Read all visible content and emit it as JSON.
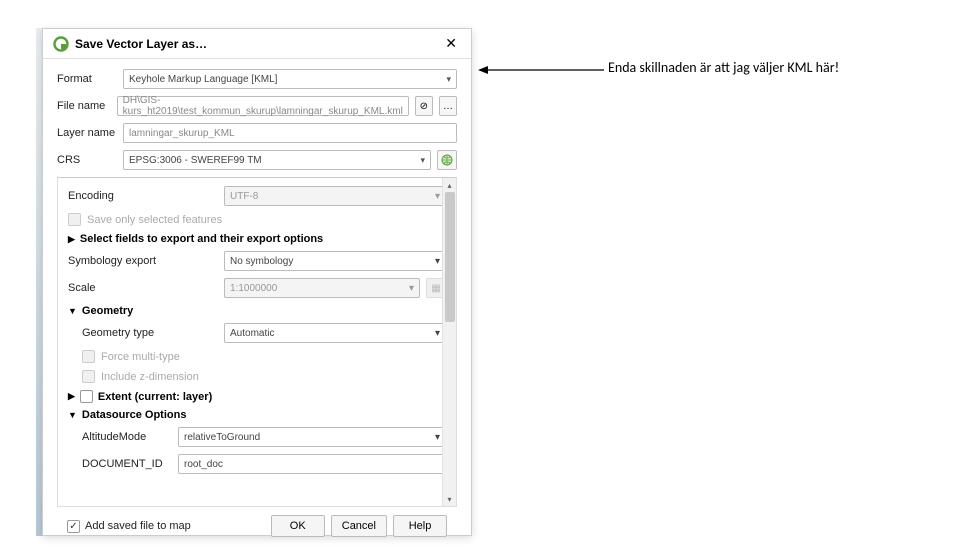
{
  "annotation": "Enda skillnaden är att jag väljer KML här!",
  "dialog": {
    "title": "Save Vector Layer as…",
    "format_label": "Format",
    "format_value": "Keyhole Markup Language [KML]",
    "filename_label": "File name",
    "filename_value": "DH\\GIS-kurs_ht2019\\test_kommun_skurup\\lamningar_skurup_KML.kml",
    "browse_btn": "…",
    "layername_label": "Layer name",
    "layername_value": "lamningar_skurup_KML",
    "crs_label": "CRS",
    "crs_value": "EPSG:3006 - SWEREF99 TM",
    "encoding_label": "Encoding",
    "encoding_value": "UTF-8",
    "save_selected": "Save only selected features",
    "select_fields_head": "Select fields to export and their export options",
    "symbology_label": "Symbology export",
    "symbology_value": "No symbology",
    "scale_label": "Scale",
    "scale_value": "1:1000000",
    "geometry_head": "Geometry",
    "geomtype_label": "Geometry type",
    "geomtype_value": "Automatic",
    "force_multi": "Force multi-type",
    "include_z": "Include z-dimension",
    "extent_head": "Extent (current: layer)",
    "datasource_head": "Datasource Options",
    "altitude_label": "AltitudeMode",
    "altitude_value": "relativeToGround",
    "docid_label": "DOCUMENT_ID",
    "docid_value": "root_doc",
    "add_saved": "Add saved file to map",
    "ok": "OK",
    "cancel": "Cancel",
    "help": "Help"
  }
}
